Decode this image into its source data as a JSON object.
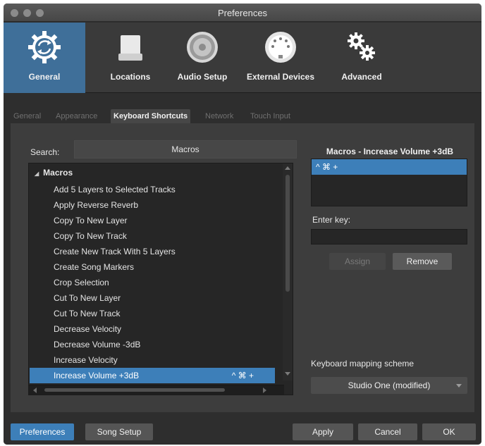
{
  "window": {
    "title": "Preferences"
  },
  "toolbar": {
    "items": [
      {
        "label": "General",
        "icon": "sync-gear-icon",
        "active": true
      },
      {
        "label": "Locations",
        "icon": "drive-icon",
        "active": false
      },
      {
        "label": "Audio Setup",
        "icon": "speaker-icon",
        "active": false
      },
      {
        "label": "External Devices",
        "icon": "midi-port-icon",
        "active": false
      },
      {
        "label": "Advanced",
        "icon": "gears-icon",
        "active": false
      }
    ]
  },
  "tabs": [
    {
      "label": "General",
      "active": false
    },
    {
      "label": "Appearance",
      "active": false
    },
    {
      "label": "Keyboard Shortcuts",
      "active": true
    },
    {
      "label": "Network",
      "active": false
    },
    {
      "label": "Touch Input",
      "active": false
    }
  ],
  "search": {
    "label": "Search:",
    "value": "Macros"
  },
  "command_list": {
    "group": "Macros",
    "items": [
      {
        "label": "Add 5 Layers to Selected Tracks",
        "shortcut": ""
      },
      {
        "label": "Apply Reverse Reverb",
        "shortcut": ""
      },
      {
        "label": "Copy To New Layer",
        "shortcut": ""
      },
      {
        "label": "Copy To New Track",
        "shortcut": ""
      },
      {
        "label": "Create New Track With 5 Layers",
        "shortcut": ""
      },
      {
        "label": "Create Song Markers",
        "shortcut": ""
      },
      {
        "label": "Crop Selection",
        "shortcut": ""
      },
      {
        "label": "Cut To New Layer",
        "shortcut": ""
      },
      {
        "label": "Cut To New Track",
        "shortcut": ""
      },
      {
        "label": "Decrease Velocity",
        "shortcut": ""
      },
      {
        "label": "Decrease Volume -3dB",
        "shortcut": ""
      },
      {
        "label": "Increase Velocity",
        "shortcut": ""
      },
      {
        "label": "Increase Volume +3dB",
        "shortcut": "^ ⌘ +",
        "selected": true
      }
    ]
  },
  "detail": {
    "title": "Macros - Increase Volume +3dB",
    "shortcuts": [
      "^ ⌘ +"
    ],
    "enter_key_label": "Enter key:",
    "enter_key_value": "",
    "assign_label": "Assign",
    "remove_label": "Remove",
    "mapping_label": "Keyboard mapping scheme",
    "mapping_value": "Studio One (modified)"
  },
  "footer": {
    "preferences_label": "Preferences",
    "song_setup_label": "Song Setup",
    "apply_label": "Apply",
    "cancel_label": "Cancel",
    "ok_label": "OK"
  },
  "colors": {
    "accent": "#3d7fb9",
    "toolbar_active": "#3f6f99",
    "background": "#2e2e2e"
  }
}
